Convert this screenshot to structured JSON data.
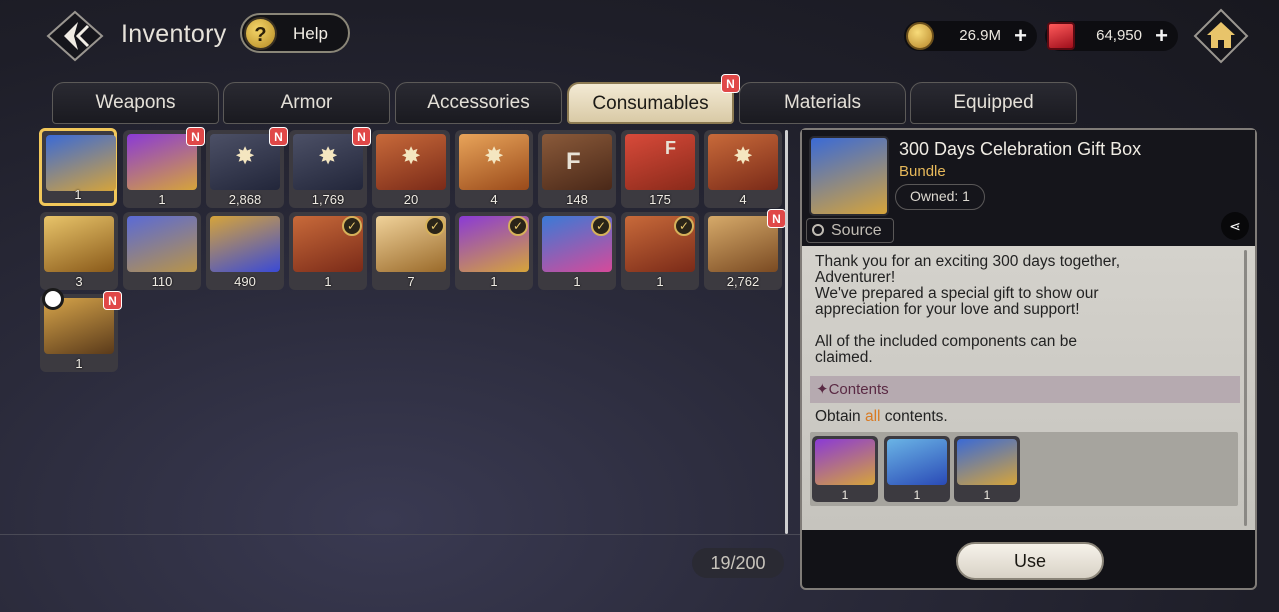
{
  "header": {
    "title": "Inventory",
    "help_label": "Help",
    "help_icon_glyph": "?",
    "gold": "26.9M",
    "gems": "64,950",
    "plus_glyph": "+"
  },
  "tabs": [
    {
      "label": "Weapons",
      "active": false
    },
    {
      "label": "Armor",
      "active": false
    },
    {
      "label": "Accessories",
      "active": false
    },
    {
      "label": "Consumables",
      "active": true,
      "new": true
    },
    {
      "label": "Materials",
      "active": false
    },
    {
      "label": "Equipped",
      "active": false
    }
  ],
  "badge_text": "N",
  "items": [
    {
      "count": "1",
      "icon": "gift-box-300-icon",
      "selected": true
    },
    {
      "count": "1",
      "icon": "purple-box-icon",
      "new": true
    },
    {
      "count": "2,868",
      "icon": "dark-star-card-icon",
      "new": true
    },
    {
      "count": "1,769",
      "icon": "dark-star-card-icon",
      "new": true
    },
    {
      "count": "20",
      "icon": "red-star-card-icon"
    },
    {
      "count": "4",
      "icon": "orange-star-card-icon"
    },
    {
      "count": "148",
      "icon": "f-card-icon",
      "letter": "F"
    },
    {
      "count": "175",
      "icon": "red-chest-f-icon",
      "letter": "F"
    },
    {
      "count": "4",
      "icon": "red-star-card-icon"
    },
    {
      "count": "3",
      "icon": "gold-chest-icon"
    },
    {
      "count": "110",
      "icon": "blue-chest-icon"
    },
    {
      "count": "490",
      "icon": "blue-gold-chest-icon"
    },
    {
      "count": "1",
      "icon": "check-card-icon"
    },
    {
      "count": "7",
      "icon": "check-card-icon"
    },
    {
      "count": "1",
      "icon": "purple-box-check-icon"
    },
    {
      "count": "1",
      "icon": "pink-box-check-icon"
    },
    {
      "count": "1",
      "icon": "red-check-card-icon"
    },
    {
      "count": "2,762",
      "icon": "chest-key-icon",
      "new": true
    },
    {
      "count": "1",
      "icon": "ticket-timer-icon",
      "new": true
    }
  ],
  "capacity": "19/200",
  "detail": {
    "name": "300 Days Celebration Gift Box",
    "type": "Bundle",
    "owned": "Owned: 1",
    "source_label": "Source",
    "share_glyph": "⋖",
    "description": "Thank you for an exciting 300 days together,\nAdventurer!\nWe've prepared a special gift to show our\nappreciation for your love and support!\n\nAll of the included components can be\nclaimed.",
    "contents_label": "✦Contents",
    "obtain_prefix": "Obtain ",
    "obtain_highlight": "all",
    "obtain_suffix": " contents.",
    "contents": [
      {
        "count": "1",
        "icon": "purple-box-check-icon"
      },
      {
        "count": "1",
        "icon": "blue-gift-300-icon"
      },
      {
        "count": "1",
        "icon": "gift-box-300-icon"
      }
    ],
    "use_label": "Use"
  },
  "colors": {
    "accent_gold": "#f2c85a",
    "new_badge": "#e04848",
    "bundle_text": "#e6b85a",
    "highlight": "#d97a22"
  }
}
